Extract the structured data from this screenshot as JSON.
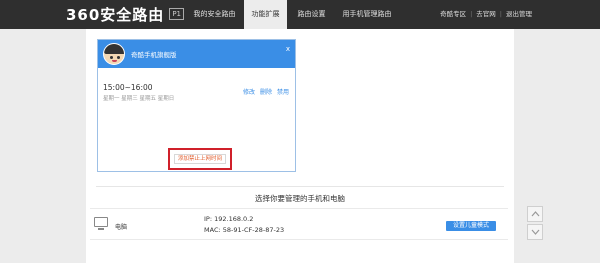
{
  "header": {
    "logo_text": "360安全路由",
    "logo_badge": "P1",
    "tabs": [
      {
        "label": "我的安全路由"
      },
      {
        "label": "功能扩展"
      },
      {
        "label": "路由设置"
      },
      {
        "label": "用手机管理路由"
      }
    ],
    "links": {
      "home": "奇酷专区",
      "website": "去官网",
      "logout": "退出管理"
    }
  },
  "schedule_card": {
    "title": "奇酷手机旗舰版",
    "close": "x",
    "time_range": "15:00~16:00",
    "days": "星期一 星期三 星期五 星期日",
    "actions": {
      "edit": "修改",
      "delete": "删除",
      "disable": "禁用"
    },
    "add_button": "添加禁止上网时间"
  },
  "device_section": {
    "title": "选择你要管理的手机和电脑",
    "device": {
      "name": "电脑",
      "ip": "IP: 192.168.0.2",
      "mac": "MAC: 58-91-CF-28-87-23",
      "button": "设置儿童模式"
    }
  },
  "colors": {
    "topbar": "#2f2f2f",
    "accent": "#3a8ee6",
    "highlight": "#d0202a"
  },
  "icons": [
    "avatar",
    "close-icon",
    "computer-icon",
    "chevron-up-icon",
    "chevron-down-icon"
  ]
}
